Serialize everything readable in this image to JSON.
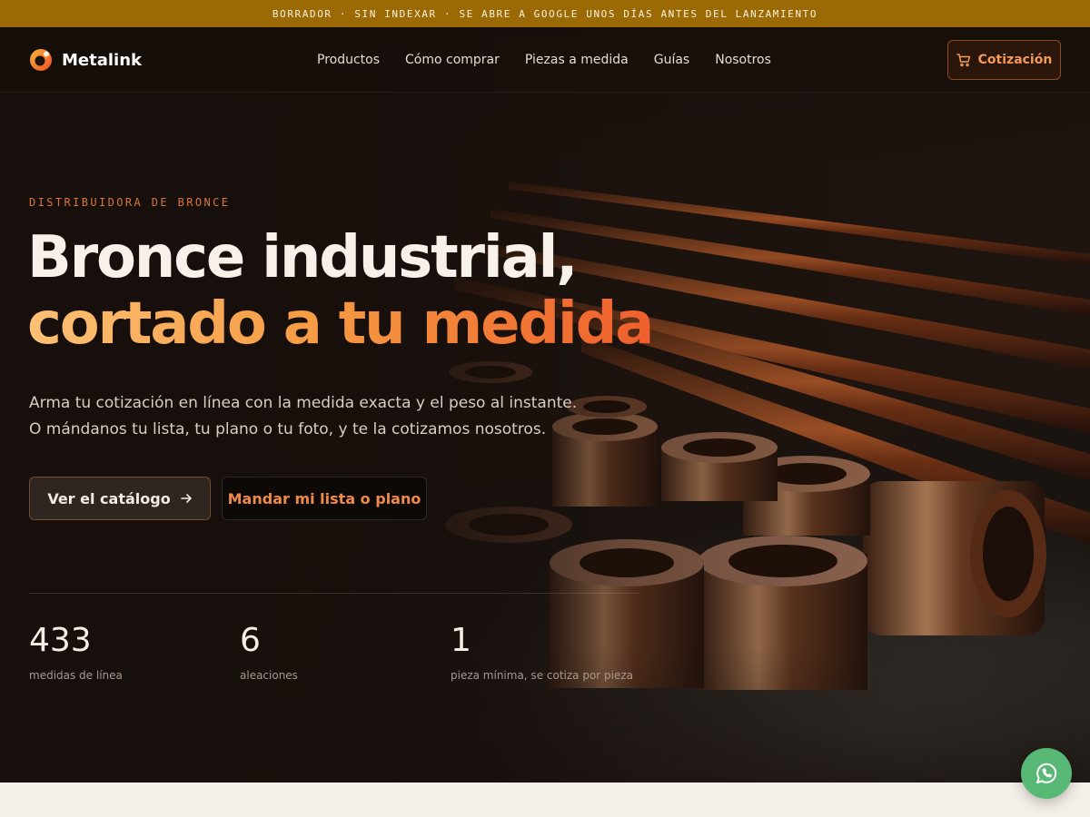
{
  "banner": {
    "text": "BORRADOR · SIN INDEXAR · SE ABRE A GOOGLE UNOS DÍAS ANTES DEL LANZAMIENTO"
  },
  "brand": {
    "name": "Metalink",
    "accent": "#f26b2a",
    "logo_icon": "circle-logo-icon"
  },
  "nav": {
    "items": [
      {
        "label": "Productos"
      },
      {
        "label": "Cómo comprar"
      },
      {
        "label": "Piezas a medida"
      },
      {
        "label": "Guías"
      },
      {
        "label": "Nosotros"
      }
    ],
    "quote_button": {
      "label": "Cotización",
      "icon": "cart-icon"
    }
  },
  "hero": {
    "eyebrow": "DISTRIBUIDORA DE BRONCE",
    "headline_line1": "Bronce industrial,",
    "headline_line2": "cortado a tu medida",
    "subtitle_line1": "Arma tu cotización en línea con la medida exacta y el peso al instante.",
    "subtitle_line2": "O mándanos tu lista, tu plano o tu foto, y te la cotizamos nosotros.",
    "primary_button": {
      "label": "Ver el catálogo",
      "icon": "arrow-right-icon"
    },
    "secondary_button": {
      "label": "Mandar mi lista o plano"
    }
  },
  "stats": [
    {
      "value": "433",
      "label": "medidas de línea"
    },
    {
      "value": "6",
      "label": "aleaciones"
    },
    {
      "value": "1",
      "label": "pieza mínima, se cotiza por pieza"
    }
  ],
  "whatsapp": {
    "icon": "whatsapp-icon",
    "color": "#58b875"
  },
  "colors": {
    "banner": "#9c6a04",
    "hero_bg": "#170f0b",
    "page_bg": "#f4efe9"
  }
}
